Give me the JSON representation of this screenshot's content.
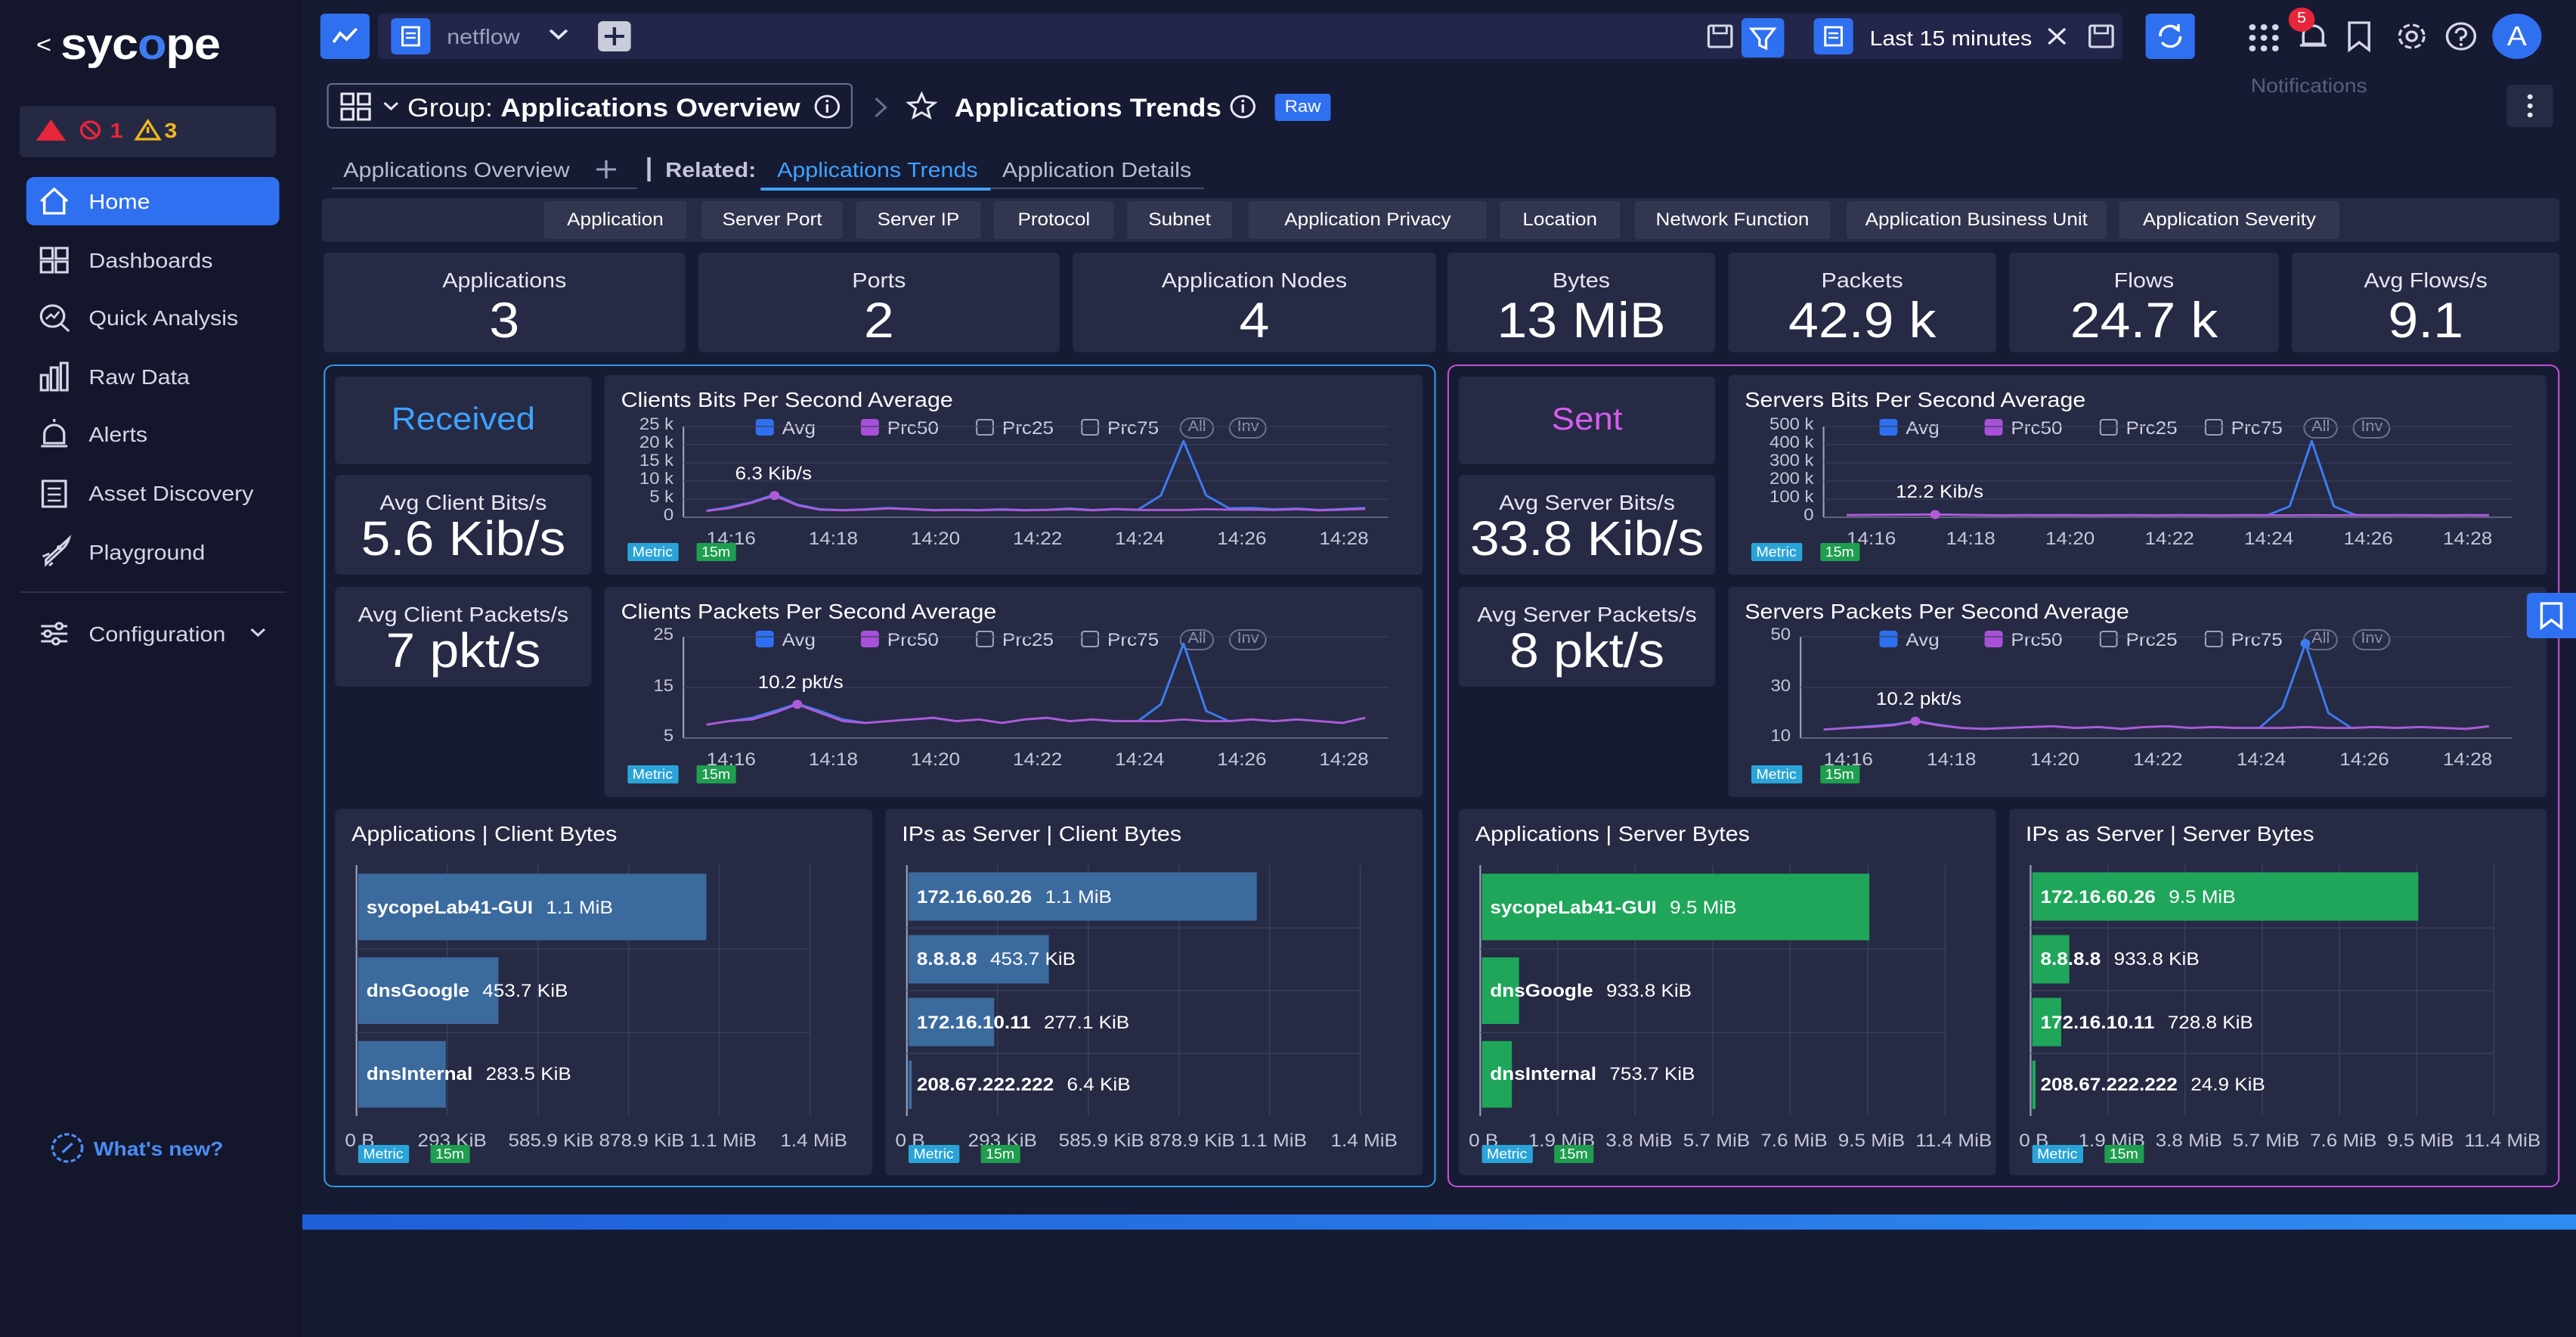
{
  "sidebar": {
    "logo_parts": [
      "syc",
      "o",
      "pe"
    ],
    "alarms": {
      "critical": "1",
      "warnings": "3"
    },
    "items": [
      {
        "label": "Home",
        "icon": "home-icon",
        "active": true
      },
      {
        "label": "Dashboards",
        "icon": "grid-icon"
      },
      {
        "label": "Quick Analysis",
        "icon": "magnifier-chart-icon"
      },
      {
        "label": "Raw Data",
        "icon": "bar-chart-icon"
      },
      {
        "label": "Alerts",
        "icon": "alarm-icon"
      },
      {
        "label": "Asset Discovery",
        "icon": "clipboard-icon"
      },
      {
        "label": "Playground",
        "icon": "rocket-icon"
      }
    ],
    "configuration": "Configuration",
    "whats_new": "What's new?"
  },
  "topbar": {
    "source": "netflow",
    "time_range": "Last 15 minutes",
    "notifications_count": "5",
    "notifications_tooltip": "Notifications",
    "avatar": "A"
  },
  "header": {
    "group_prefix": "Group:",
    "group_name": "Applications Overview",
    "page_title": "Applications Trends",
    "badge": "Raw"
  },
  "tabs": {
    "main": "Applications Overview",
    "related_label": "Related:",
    "related": [
      "Applications Trends",
      "Application Details"
    ]
  },
  "filters": [
    "Application",
    "Server Port",
    "Server IP",
    "Protocol",
    "Subnet",
    "Application Privacy",
    "Location",
    "Network Function",
    "Application Business Unit",
    "Application Severity"
  ],
  "stats": [
    {
      "title": "Applications",
      "value": "3"
    },
    {
      "title": "Ports",
      "value": "2"
    },
    {
      "title": "Application Nodes",
      "value": "4"
    },
    {
      "title": "Bytes",
      "value": "13 MiB"
    },
    {
      "title": "Packets",
      "value": "42.9 k"
    },
    {
      "title": "Flows",
      "value": "24.7 k"
    },
    {
      "title": "Avg Flows/s",
      "value": "9.1"
    }
  ],
  "received": {
    "label": "Received",
    "kpi1_title": "Avg Client Bits/s",
    "kpi1_value": "5.6 Kib/s",
    "kpi2_title": "Avg Client Packets/s",
    "kpi2_value": "7 pkt/s"
  },
  "sent": {
    "label": "Sent",
    "kpi1_title": "Avg Server Bits/s",
    "kpi1_value": "33.8 Kib/s",
    "kpi2_title": "Avg Server Packets/s",
    "kpi2_value": "8 pkt/s"
  },
  "legend": {
    "avg": "Avg",
    "prc50": "Prc50",
    "prc25": "Prc25",
    "prc75": "Prc75",
    "all": "All",
    "inv": "Inv"
  },
  "tags": {
    "metric": "Metric",
    "interval": "15m"
  },
  "colors": {
    "avg": "#3d7cf0",
    "prc50": "#b05ad8",
    "client_bar": "#3b6a9e",
    "server_bar": "#1fa65a",
    "received_border": "#2b9be0",
    "sent_border": "#c04fd4"
  },
  "chart_data": [
    {
      "id": "c1",
      "type": "line",
      "title": "Clients Bits Per Second Average",
      "x": [
        "14:16",
        "14:18",
        "14:20",
        "14:22",
        "14:24",
        "14:26",
        "14:28"
      ],
      "yticks": [
        "25 k",
        "20 k",
        "15 k",
        "10 k",
        "5 k",
        "0"
      ],
      "ylim": [
        0,
        25000
      ],
      "annotation": "6.3 Kib/s",
      "series": [
        {
          "name": "Avg",
          "values": [
            1800,
            2800,
            4200,
            6300,
            3500,
            2200,
            2000,
            2200,
            2600,
            2300,
            2000,
            2100,
            2000,
            2200,
            2000,
            2100,
            2400,
            2000,
            2300,
            2100,
            6000,
            21000,
            6000,
            2500,
            2600,
            2200,
            2400,
            2000,
            2300,
            2600
          ]
        },
        {
          "name": "Prc50",
          "values": [
            1700,
            2500,
            4000,
            6000,
            3300,
            2100,
            1900,
            2100,
            2400,
            2200,
            1900,
            2000,
            1900,
            2100,
            1900,
            2000,
            2200,
            1900,
            2200,
            2000,
            2000,
            2000,
            2200,
            2100,
            2100,
            2000,
            2200,
            1900,
            2100,
            2300
          ]
        }
      ]
    },
    {
      "id": "c2",
      "type": "line",
      "title": "Clients Packets Per Second Average",
      "x": [
        "14:16",
        "14:18",
        "14:20",
        "14:22",
        "14:24",
        "14:26",
        "14:28"
      ],
      "yticks": [
        "25",
        "15",
        "5"
      ],
      "ylim": [
        0,
        30
      ],
      "annotation": "10.2 pkt/s",
      "series": [
        {
          "name": "Avg",
          "values": [
            4,
            5,
            6,
            8,
            10.2,
            8,
            5.5,
            4.5,
            5,
            5.5,
            6,
            5,
            5.5,
            4.5,
            5.5,
            6,
            5,
            5.5,
            5,
            5,
            10,
            28,
            8,
            5,
            5.5,
            5,
            5.5,
            5,
            4.5,
            6
          ]
        },
        {
          "name": "Prc50",
          "values": [
            4,
            5,
            5.5,
            7.5,
            10,
            7.5,
            5,
            4.5,
            5,
            5.5,
            6,
            5,
            5.5,
            4.5,
            5.5,
            6,
            5,
            5.5,
            5,
            5,
            5,
            5.5,
            5,
            5,
            5.5,
            5,
            5.5,
            5,
            4.5,
            6
          ]
        }
      ]
    },
    {
      "id": "c3",
      "type": "line",
      "title": "Servers Bits Per Second Average",
      "x": [
        "14:16",
        "14:18",
        "14:20",
        "14:22",
        "14:24",
        "14:26",
        "14:28"
      ],
      "yticks": [
        "500 k",
        "400 k",
        "300 k",
        "200 k",
        "100 k",
        "0"
      ],
      "ylim": [
        0,
        500000
      ],
      "annotation": "12.2 Kib/s",
      "series": [
        {
          "name": "Avg",
          "values": [
            12000,
            13000,
            14000,
            15000,
            15500,
            14000,
            12000,
            11000,
            12000,
            11500,
            12000,
            11000,
            11500,
            12000,
            11000,
            12000,
            11500,
            11000,
            12000,
            11500,
            60000,
            420000,
            60000,
            12000,
            11500,
            12000,
            11500,
            11000,
            12000,
            11500
          ]
        },
        {
          "name": "Prc50",
          "values": [
            11500,
            12500,
            13500,
            14500,
            15000,
            13500,
            11500,
            10500,
            11500,
            11000,
            11500,
            10500,
            11000,
            11500,
            10500,
            11500,
            11000,
            10500,
            11500,
            11000,
            11000,
            11500,
            11000,
            11500,
            11000,
            11500,
            11000,
            10500,
            11500,
            11000
          ]
        }
      ]
    },
    {
      "id": "c4",
      "type": "line",
      "title": "Servers Packets Per Second Average",
      "x": [
        "14:16",
        "14:18",
        "14:20",
        "14:22",
        "14:24",
        "14:26",
        "14:28"
      ],
      "yticks": [
        "50",
        "30",
        "10"
      ],
      "ylim": [
        0,
        60
      ],
      "annotation": "10.2 pkt/s",
      "series": [
        {
          "name": "Avg",
          "values": [
            5,
            6,
            7,
            8,
            10.2,
            8,
            6,
            5.5,
            6,
            6.5,
            7,
            6,
            6.5,
            5.5,
            6.5,
            7,
            6,
            6.5,
            6,
            6,
            18,
            56,
            15,
            6,
            6.5,
            6,
            6.5,
            6,
            5.5,
            7
          ]
        },
        {
          "name": "Prc50",
          "values": [
            5,
            6,
            6.5,
            7.5,
            10,
            7.5,
            6,
            5.5,
            6,
            6.5,
            7,
            6,
            6.5,
            5.5,
            6.5,
            7,
            6,
            6.5,
            6,
            6,
            6,
            6.5,
            6,
            6,
            6.5,
            6,
            6.5,
            6,
            5.5,
            7
          ]
        }
      ]
    },
    {
      "id": "b1",
      "type": "bar",
      "title": "Applications | Client Bytes",
      "categories": [
        "sycopeLab41-GUI",
        "dnsGoogle",
        "dnsInternal"
      ],
      "labels": [
        "1.1 MiB",
        "453.7 KiB",
        "283.5 KiB"
      ],
      "values": [
        1126,
        453.7,
        283.5
      ],
      "xmax": 1466,
      "xticks": [
        "0 B",
        "293 KiB",
        "585.9 KiB",
        "878.9 KiB",
        "1.1 MiB",
        "1.4 MiB"
      ]
    },
    {
      "id": "b2",
      "type": "bar",
      "title": "IPs as Server | Client Bytes",
      "categories": [
        "172.16.60.26",
        "8.8.8.8",
        "172.16.10.11",
        "208.67.222.222"
      ],
      "labels": [
        "1.1 MiB",
        "453.7 KiB",
        "277.1 KiB",
        "6.4 KiB"
      ],
      "values": [
        1126,
        453.7,
        277.1,
        6.4
      ],
      "xmax": 1466,
      "xticks": [
        "0 B",
        "293 KiB",
        "585.9 KiB",
        "878.9 KiB",
        "1.1 MiB",
        "1.4 MiB"
      ]
    },
    {
      "id": "b3",
      "type": "bar",
      "title": "Applications | Server Bytes",
      "categories": [
        "sycopeLab41-GUI",
        "dnsGoogle",
        "dnsInternal"
      ],
      "labels": [
        "9.5 MiB",
        "933.8 KiB",
        "753.7 KiB"
      ],
      "values": [
        9.5,
        0.912,
        0.736
      ],
      "xmax": 11.4,
      "xticks": [
        "0 B",
        "1.9 MiB",
        "3.8 MiB",
        "5.7 MiB",
        "7.6 MiB",
        "9.5 MiB",
        "11.4 MiB"
      ]
    },
    {
      "id": "b4",
      "type": "bar",
      "title": "IPs as Server | Server Bytes",
      "categories": [
        "172.16.60.26",
        "8.8.8.8",
        "172.16.10.11",
        "208.67.222.222"
      ],
      "labels": [
        "9.5 MiB",
        "933.8 KiB",
        "728.8 KiB",
        "24.9 KiB"
      ],
      "values": [
        9.5,
        0.912,
        0.712,
        0.024
      ],
      "xmax": 11.4,
      "xticks": [
        "0 B",
        "1.9 MiB",
        "3.8 MiB",
        "5.7 MiB",
        "7.6 MiB",
        "9.5 MiB",
        "11.4 MiB"
      ]
    }
  ]
}
